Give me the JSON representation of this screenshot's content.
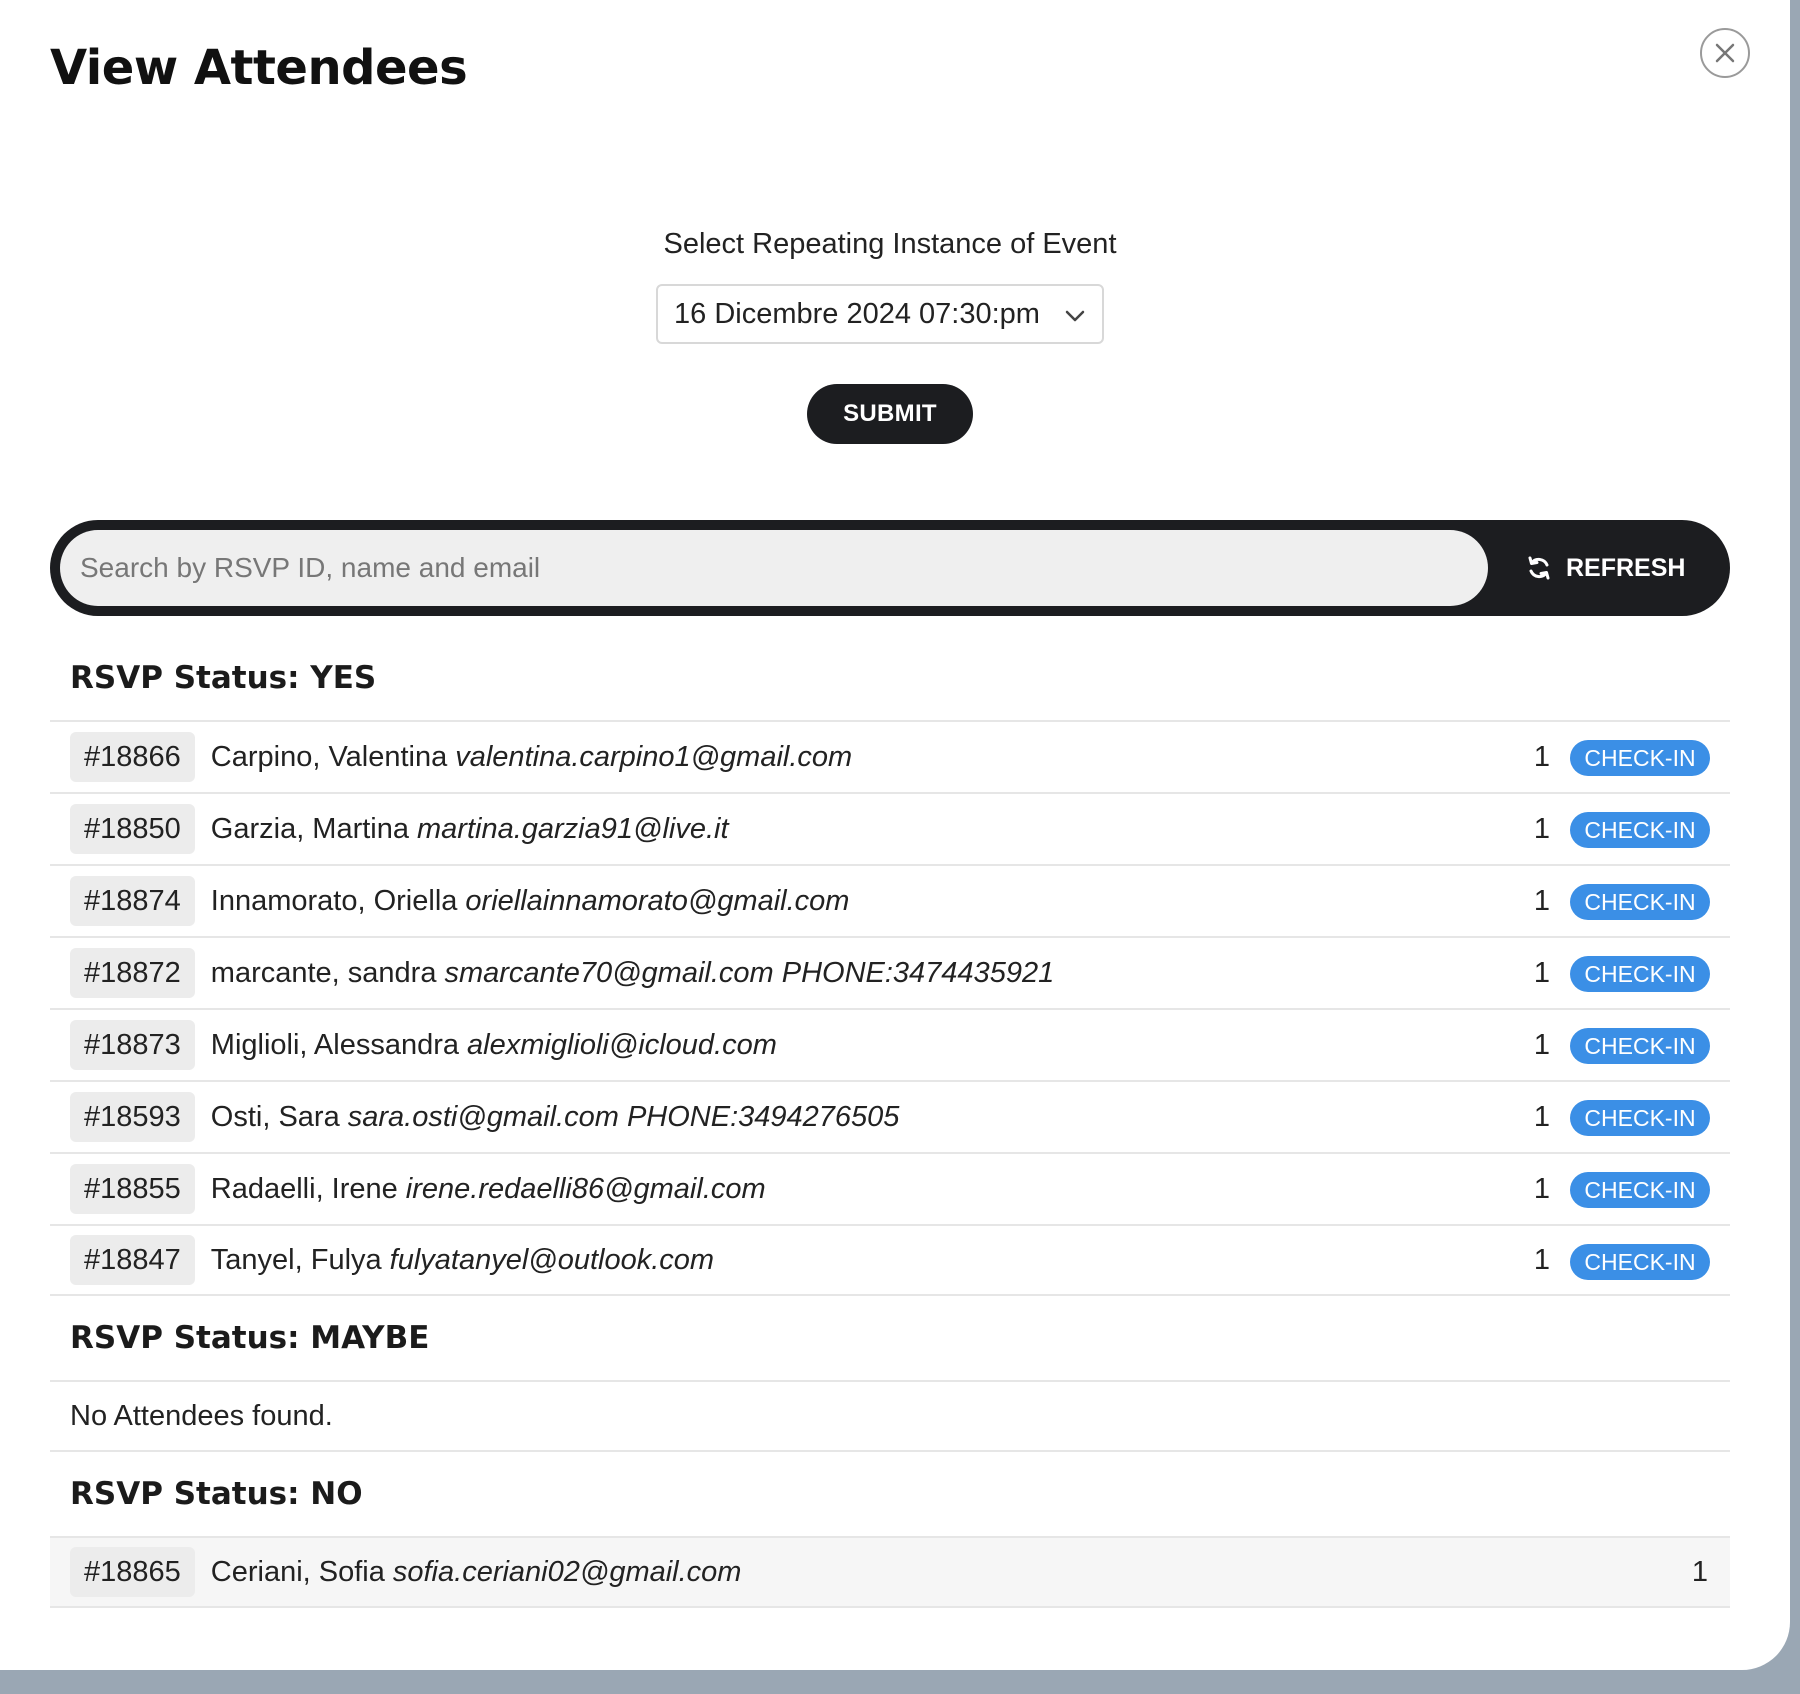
{
  "modal": {
    "title": "View Attendees"
  },
  "instance": {
    "label": "Select Repeating Instance of Event",
    "selected": "16 Dicembre 2024 07:30:pm",
    "submit_label": "SUBMIT"
  },
  "search": {
    "placeholder": "Search by RSVP ID, name and email",
    "refresh_label": "REFRESH"
  },
  "sections": {
    "yes": {
      "title": "RSVP Status: YES",
      "rows": [
        {
          "id": "#18866",
          "name": "Carpino, Valentina",
          "email": "valentina.carpino1@gmail.com",
          "count": "1",
          "action": "CHECK-IN"
        },
        {
          "id": "#18850",
          "name": "Garzia, Martina",
          "email": "martina.garzia91@live.it",
          "count": "1",
          "action": "CHECK-IN"
        },
        {
          "id": "#18874",
          "name": "Innamorato, Oriella",
          "email": "oriellainnamorato@gmail.com",
          "count": "1",
          "action": "CHECK-IN"
        },
        {
          "id": "#18872",
          "name": "marcante, sandra",
          "email": "smarcante70@gmail.com PHONE:3474435921",
          "count": "1",
          "action": "CHECK-IN"
        },
        {
          "id": "#18873",
          "name": "Miglioli, Alessandra",
          "email": "alexmiglioli@icloud.com",
          "count": "1",
          "action": "CHECK-IN"
        },
        {
          "id": "#18593",
          "name": "Osti, Sara",
          "email": "sara.osti@gmail.com PHONE:3494276505",
          "count": "1",
          "action": "CHECK-IN"
        },
        {
          "id": "#18855",
          "name": "Radaelli, Irene",
          "email": "irene.redaelli86@gmail.com",
          "count": "1",
          "action": "CHECK-IN"
        },
        {
          "id": "#18847",
          "name": "Tanyel, Fulya",
          "email": "fulyatanyel@outlook.com",
          "count": "1",
          "action": "CHECK-IN"
        }
      ]
    },
    "maybe": {
      "title": "RSVP Status: MAYBE",
      "empty_text": "No Attendees found."
    },
    "no": {
      "title": "RSVP Status: NO",
      "rows": [
        {
          "id": "#18865",
          "name": "Ceriani, Sofia",
          "email": "sofia.ceriani02@gmail.com",
          "count": "1"
        }
      ]
    }
  },
  "icons": {
    "close": "close-icon",
    "chevron": "chevron-down-icon",
    "refresh": "refresh-icon"
  },
  "colors": {
    "dark": "#1c1d20",
    "checkin": "#3b8fe6",
    "backdrop": "#9aa7b4"
  }
}
